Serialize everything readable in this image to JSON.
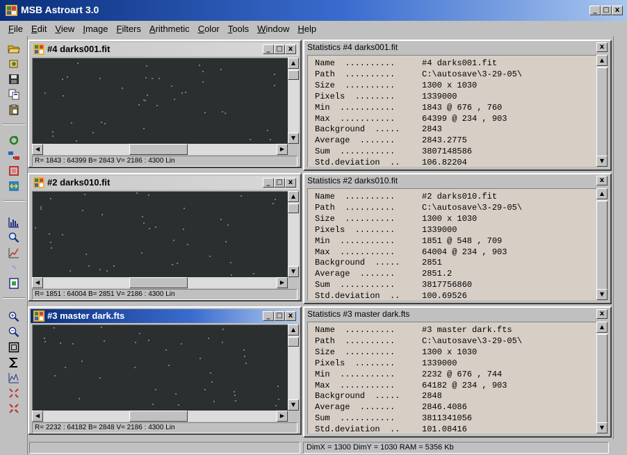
{
  "app": {
    "title": "MSB Astroart 3.0",
    "caption_buttons": [
      "_",
      "□",
      "x"
    ]
  },
  "menubar": {
    "items": [
      "File",
      "Edit",
      "View",
      "Image",
      "Filters",
      "Arithmetic",
      "Color",
      "Tools",
      "Window",
      "Help"
    ]
  },
  "toolbar": {
    "icons": [
      "open-folder-icon",
      "copy-icon",
      "save-icon",
      "duplicate-icon",
      "paste-icon",
      "refresh-icon",
      "convert-icon",
      "crop-icon",
      "resize-icon",
      "histogram-icon",
      "zoom-icon",
      "plot-icon",
      "stars-icon",
      "info-icon",
      "zoom-in-icon",
      "zoom-out-icon",
      "frame-icon",
      "sum-icon",
      "graph-icon",
      "expand-icon",
      "shrink-icon"
    ]
  },
  "windows": [
    {
      "title": "#4 darks001.fit",
      "active": false,
      "status": "R= 1843 : 64399   B= 2843   V= 2186 : 4300 Lin",
      "stats_title": "Statistics #4 darks001.fit",
      "stats": [
        {
          "label": "Name  ..........",
          "value": "#4 darks001.fit"
        },
        {
          "label": "Path  ..........",
          "value": "C:\\autosave\\3-29-05\\"
        },
        {
          "label": "Size  ..........",
          "value": "1300 x 1030"
        },
        {
          "label": "Pixels  ........",
          "value": "1339000"
        },
        {
          "label": "Min  ...........",
          "value": "1843 @ 676 , 760"
        },
        {
          "label": "Max  ...........",
          "value": "64399 @ 234 , 903"
        },
        {
          "label": "Background  .....",
          "value": "2843"
        },
        {
          "label": "Average  .......",
          "value": "2843.2775"
        },
        {
          "label": "Sum  ...........",
          "value": "3807148586"
        },
        {
          "label": "Std.deviation  ..",
          "value": "106.82204"
        }
      ]
    },
    {
      "title": "#2 darks010.fit",
      "active": false,
      "status": "R= 1851 : 64004   B= 2851   V= 2186 : 4300 Lin",
      "stats_title": "Statistics #2 darks010.fit",
      "stats": [
        {
          "label": "Name  ..........",
          "value": "#2 darks010.fit"
        },
        {
          "label": "Path  ..........",
          "value": "C:\\autosave\\3-29-05\\"
        },
        {
          "label": "Size  ..........",
          "value": "1300 x 1030"
        },
        {
          "label": "Pixels  ........",
          "value": "1339000"
        },
        {
          "label": "Min  ...........",
          "value": "1851 @ 548 , 709"
        },
        {
          "label": "Max  ...........",
          "value": "64004 @ 234 , 903"
        },
        {
          "label": "Background  .....",
          "value": "2851"
        },
        {
          "label": "Average  .......",
          "value": "2851.2"
        },
        {
          "label": "Sum  ...........",
          "value": "3817756860"
        },
        {
          "label": "Std.deviation  ..",
          "value": "100.69526"
        }
      ]
    },
    {
      "title": "#3 master dark.fts",
      "active": true,
      "status": "R= 2232 : 64182   B= 2848   V= 2186 : 4300 Lin",
      "stats_title": "Statistics #3 master dark.fts",
      "stats": [
        {
          "label": "Name  ..........",
          "value": "#3 master dark.fts"
        },
        {
          "label": "Path  ..........",
          "value": "C:\\autosave\\3-29-05\\"
        },
        {
          "label": "Size  ..........",
          "value": "1300 x 1030"
        },
        {
          "label": "Pixels  ........",
          "value": "1339000"
        },
        {
          "label": "Min  ...........",
          "value": "2232 @ 676 , 744"
        },
        {
          "label": "Max  ...........",
          "value": "64182 @ 234 , 903"
        },
        {
          "label": "Background  .....",
          "value": "2848"
        },
        {
          "label": "Average  .......",
          "value": "2846.4086"
        },
        {
          "label": "Sum  ...........",
          "value": "3811341056"
        },
        {
          "label": "Std.deviation  ..",
          "value": "101.08416"
        }
      ]
    }
  ],
  "statusbar": {
    "dims": "DimX = 1300   DimY = 1030   RAM = 5356 Kb"
  },
  "colors": {
    "active_title": "#0a2f7a",
    "stats_background": "#d7cec6",
    "image_background": "#2b2f30"
  }
}
